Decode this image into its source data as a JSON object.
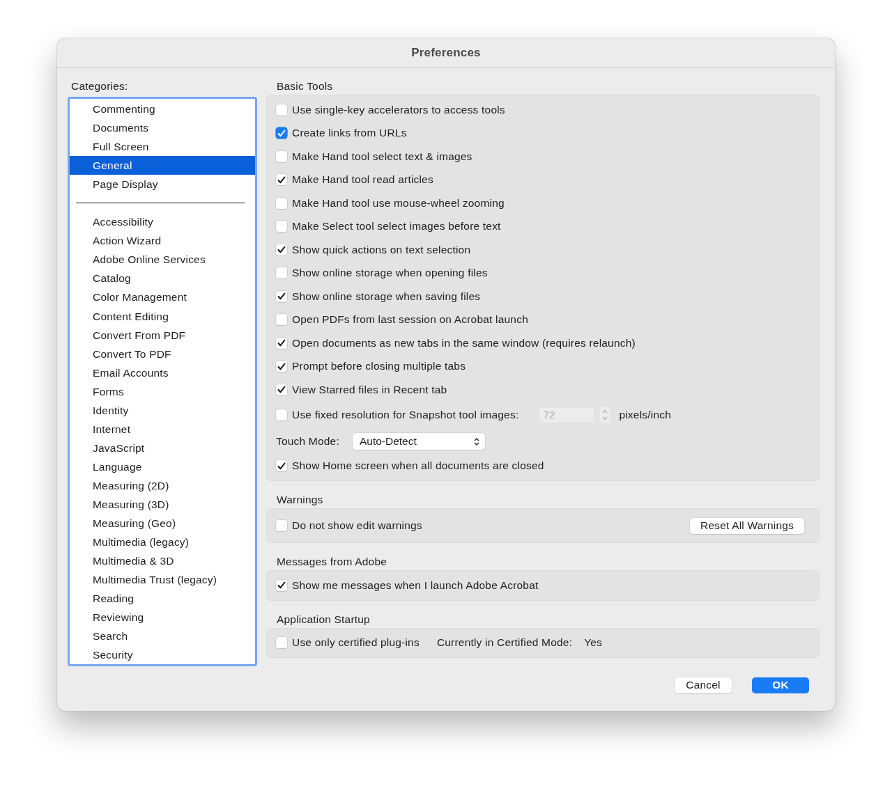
{
  "window": {
    "title": "Preferences"
  },
  "categories": {
    "label": "Categories:",
    "groups": [
      [
        {
          "label": "Commenting",
          "selected": false
        },
        {
          "label": "Documents",
          "selected": false
        },
        {
          "label": "Full Screen",
          "selected": false
        },
        {
          "label": "General",
          "selected": true
        },
        {
          "label": "Page Display",
          "selected": false
        }
      ],
      [
        {
          "label": "Accessibility",
          "selected": false
        },
        {
          "label": "Action Wizard",
          "selected": false
        },
        {
          "label": "Adobe Online Services",
          "selected": false
        },
        {
          "label": "Catalog",
          "selected": false
        },
        {
          "label": "Color Management",
          "selected": false
        },
        {
          "label": "Content Editing",
          "selected": false
        },
        {
          "label": "Convert From PDF",
          "selected": false
        },
        {
          "label": "Convert To PDF",
          "selected": false
        },
        {
          "label": "Email Accounts",
          "selected": false
        },
        {
          "label": "Forms",
          "selected": false
        },
        {
          "label": "Identity",
          "selected": false
        },
        {
          "label": "Internet",
          "selected": false
        },
        {
          "label": "JavaScript",
          "selected": false
        },
        {
          "label": "Language",
          "selected": false
        },
        {
          "label": "Measuring (2D)",
          "selected": false
        },
        {
          "label": "Measuring (3D)",
          "selected": false
        },
        {
          "label": "Measuring (Geo)",
          "selected": false
        },
        {
          "label": "Multimedia (legacy)",
          "selected": false
        },
        {
          "label": "Multimedia & 3D",
          "selected": false
        },
        {
          "label": "Multimedia Trust (legacy)",
          "selected": false
        },
        {
          "label": "Reading",
          "selected": false
        },
        {
          "label": "Reviewing",
          "selected": false
        },
        {
          "label": "Search",
          "selected": false
        },
        {
          "label": "Security",
          "selected": false
        }
      ]
    ]
  },
  "sections": [
    {
      "title": "Basic Tools",
      "rows": [
        {
          "kind": "checkbox",
          "label": "Use single-key accelerators to access tools",
          "checked": false,
          "focused": false
        },
        {
          "kind": "checkbox",
          "label": "Create links from URLs",
          "checked": true,
          "focused": true
        },
        {
          "kind": "checkbox",
          "label": "Make Hand tool select text & images",
          "checked": false,
          "focused": false
        },
        {
          "kind": "checkbox",
          "label": "Make Hand tool read articles",
          "checked": true,
          "focused": false
        },
        {
          "kind": "checkbox",
          "label": "Make Hand tool use mouse-wheel zooming",
          "checked": false,
          "focused": false
        },
        {
          "kind": "checkbox",
          "label": "Make Select tool select images before text",
          "checked": false,
          "focused": false
        },
        {
          "kind": "checkbox",
          "label": "Show quick actions on text selection",
          "checked": true,
          "focused": false
        },
        {
          "kind": "checkbox",
          "label": "Show online storage when opening files",
          "checked": false,
          "focused": false
        },
        {
          "kind": "checkbox",
          "label": "Show online storage when saving files",
          "checked": true,
          "focused": false
        },
        {
          "kind": "checkbox",
          "label": "Open PDFs from last session on Acrobat launch",
          "checked": false,
          "focused": false
        },
        {
          "kind": "checkbox",
          "label": "Open documents as new tabs in the same window (requires relaunch)",
          "checked": true,
          "focused": false
        },
        {
          "kind": "checkbox",
          "label": "Prompt before closing multiple tabs",
          "checked": true,
          "focused": false
        },
        {
          "kind": "checkbox",
          "label": "View Starred files in Recent tab",
          "checked": true,
          "focused": false
        },
        {
          "kind": "snapshot",
          "label": "Use fixed resolution for Snapshot tool images:",
          "checked": false,
          "focused": false,
          "value": "72",
          "disabled": true,
          "unit": "pixels/inch"
        },
        {
          "kind": "select",
          "label": "Touch Mode:",
          "value": "Auto-Detect"
        },
        {
          "kind": "checkbox",
          "label": "Show Home screen when all documents are closed",
          "checked": true,
          "focused": false
        }
      ]
    },
    {
      "title": "Warnings",
      "rows": [
        {
          "kind": "checkbox_button",
          "label": "Do not show edit warnings",
          "checked": false,
          "focused": false,
          "button": "Reset All Warnings"
        }
      ]
    },
    {
      "title": "Messages from Adobe",
      "rows": [
        {
          "kind": "checkbox",
          "label": "Show me messages when I launch Adobe Acrobat",
          "checked": true,
          "focused": false
        }
      ]
    },
    {
      "title": "Application Startup",
      "rows": [
        {
          "kind": "checkbox_status",
          "label": "Use only certified plug-ins",
          "checked": false,
          "focused": false,
          "status_label": "Currently in Certified Mode:",
          "status_value": "Yes"
        }
      ]
    }
  ],
  "buttons": [
    {
      "label": "Cancel",
      "default": false
    },
    {
      "label": "OK",
      "default": true
    }
  ]
}
